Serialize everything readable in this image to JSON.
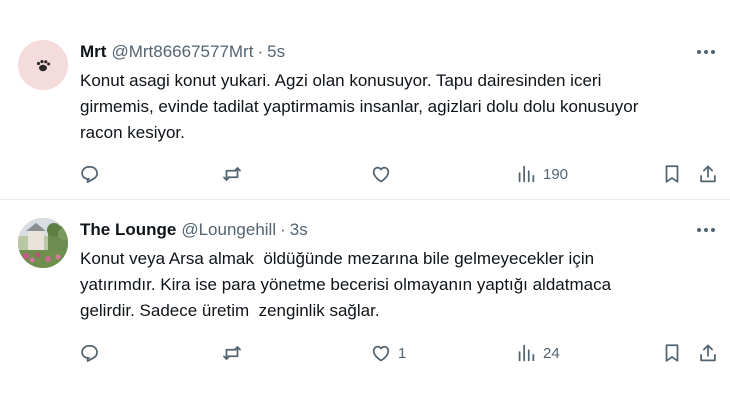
{
  "tweets": [
    {
      "name": "Mrt",
      "handle": "@Mrt86667577Mrt",
      "separator": "·",
      "time": "5s",
      "lines": [
        "Konut asagi konut yukari. Agzi olan konusuyor. Tapu dairesinden iceri",
        "girmemis, evinde tadilat yaptirmamis insanlar, agizlari dolu dolu konusuyor",
        "racon kesiyor."
      ],
      "actions": {
        "replies": "",
        "reposts": "",
        "likes": "",
        "views": "190"
      },
      "icons": [
        "reply-icon",
        "repost-icon",
        "like-icon",
        "views-icon",
        "bookmark-icon",
        "share-icon"
      ]
    },
    {
      "name": "The Lounge",
      "handle": "@Loungehill",
      "separator": "·",
      "time": "3s",
      "lines": [
        "Konut veya Arsa almak  öldüğünde mezarına bile gelmeyecekler için",
        "yatırımdır. Kira ise para yönetme becerisi olmayanın yaptığı aldatmaca",
        "gelirdir. Sadece üretim  zenginlik sağlar."
      ],
      "actions": {
        "replies": "",
        "reposts": "",
        "likes": "1",
        "views": "24"
      },
      "icons": [
        "reply-icon",
        "repost-icon",
        "like-icon",
        "views-icon",
        "bookmark-icon",
        "share-icon"
      ]
    }
  ],
  "colors": {
    "text": "#0f1419",
    "secondary": "#536471",
    "divider": "#e6ecf0",
    "background": "#ffffff"
  }
}
